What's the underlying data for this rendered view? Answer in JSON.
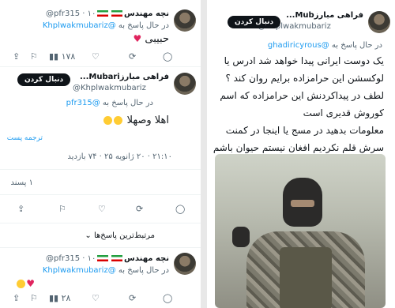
{
  "left_panel": {
    "tweet1": {
      "name": "نچه مهندس",
      "handle": "@pfr315",
      "time": "۱۰",
      "reply_prefix": "در حال پاسخ به",
      "reply_mention": "@Khplwakmubariz",
      "text": "حبیبی",
      "actions": {
        "reply": "",
        "retweet": "",
        "like": "",
        "views": "۱۷۸",
        "bookmark": "",
        "share": ""
      }
    },
    "tweet2": {
      "name": "فراهی مبارزMubari...",
      "handle": "@Khplwakmubariz",
      "follow_label": "دنبال کردن",
      "reply_prefix": "در حال پاسخ به",
      "reply_mention": "@pfr315",
      "text": "اهلا وصهلا",
      "translate_label": "ترجمه پست",
      "timestamp": "۲۱:۱۰ · ۲۰ ژانویه ۲۵ · ۷۴ بازدید",
      "likes_count": "۱ پسند",
      "related_label": "مرتبط‌ترین پاسخ‌ها"
    },
    "tweet3": {
      "name": "نچه مهندس",
      "handle": "@pfr315",
      "time": "۱۰",
      "reply_prefix": "در حال پاسخ به",
      "reply_mention": "@Khplwakmubariz",
      "actions": {
        "views": "۲۸"
      }
    }
  },
  "right_panel": {
    "name": "فراهی مبارزMub...",
    "handle": "@Khplwakmubariz",
    "follow_label": "دنبال کردن",
    "reply_prefix": "در حال پاسخ به",
    "reply_mention": "@ghadiricyrous",
    "text_lines": [
      "یک دوست ایرانی پیدا خواهد شد ادرس یا",
      "لوکسشن این حرامزاده برایم روان کند ؟",
      "لطف در پیداکردنش این حرامزاده که اسم",
      "کوروش قدیری است",
      "معلومات بدهید در مسج یا اینجا در کمنت",
      "سرش قلم نکردیم افغان نیستم حیوان باشم"
    ]
  }
}
